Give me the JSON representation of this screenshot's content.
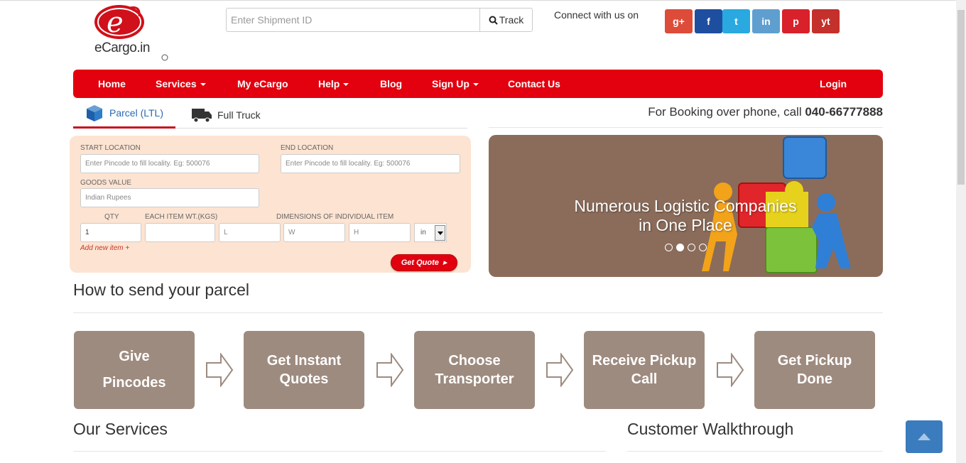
{
  "logo": {
    "text": "eCargo.in"
  },
  "track": {
    "placeholder": "Enter Shipment ID",
    "button_label": "Track"
  },
  "connect_label": "Connect with us on",
  "social": [
    {
      "name": "google-plus",
      "glyph": "g+",
      "color": "#dd4b39"
    },
    {
      "name": "facebook",
      "glyph": "f",
      "color": "#1e4ea0"
    },
    {
      "name": "twitter",
      "glyph": "t",
      "color": "#29a9e0"
    },
    {
      "name": "linkedin",
      "glyph": "in",
      "color": "#5f9fd0"
    },
    {
      "name": "pinterest",
      "glyph": "p",
      "color": "#d8212a"
    },
    {
      "name": "youtube",
      "glyph": "yt",
      "color": "#c4302b"
    }
  ],
  "nav": {
    "home": "Home",
    "services": "Services",
    "my_ecargo": "My eCargo",
    "help": "Help",
    "blog": "Blog",
    "signup": "Sign Up",
    "contact": "Contact Us",
    "login": "Login"
  },
  "tabs": {
    "parcel": "Parcel (LTL)",
    "truck": "Full Truck"
  },
  "phone": {
    "text": "For Booking over phone, call ",
    "number": "040-66777888"
  },
  "form": {
    "start_label": "START LOCATION",
    "start_placeholder": "Enter Pincode to fill locality. Eg: 500076",
    "end_label": "END LOCATION",
    "end_placeholder": "Enter Pincode to fill locality. Eg: 500076",
    "goods_label": "GOODS VALUE",
    "goods_placeholder": "Indian Rupees",
    "qty_label": "QTY",
    "weight_label": "EACH ITEM WT.(KGs)",
    "dims_label": "DIMENSIONS OF INDIVIDUAL ITEM",
    "qty_value": "1",
    "l_placeholder": "L",
    "w_placeholder": "W",
    "h_placeholder": "H",
    "unit_value": "in",
    "add_item": "Add new item +",
    "quote_button": "Get Quote"
  },
  "slider": {
    "caption_line1": "Numerous Logistic Companies",
    "caption_line2": "in One Place",
    "active_dot": 2,
    "dot_count": 4
  },
  "how_to": {
    "title": "How to send your parcel",
    "steps": [
      {
        "line1": "Give",
        "line2": "Pincodes"
      },
      {
        "line1": "Get Instant",
        "line2": "Quotes"
      },
      {
        "line1": "Choose",
        "line2": "Transporter"
      },
      {
        "line1": "Receive Pickup",
        "line2": "Call"
      },
      {
        "line1": "Get Pickup",
        "line2": "Done"
      }
    ]
  },
  "services_title": "Our Services",
  "walkthrough_title": "Customer Walkthrough"
}
